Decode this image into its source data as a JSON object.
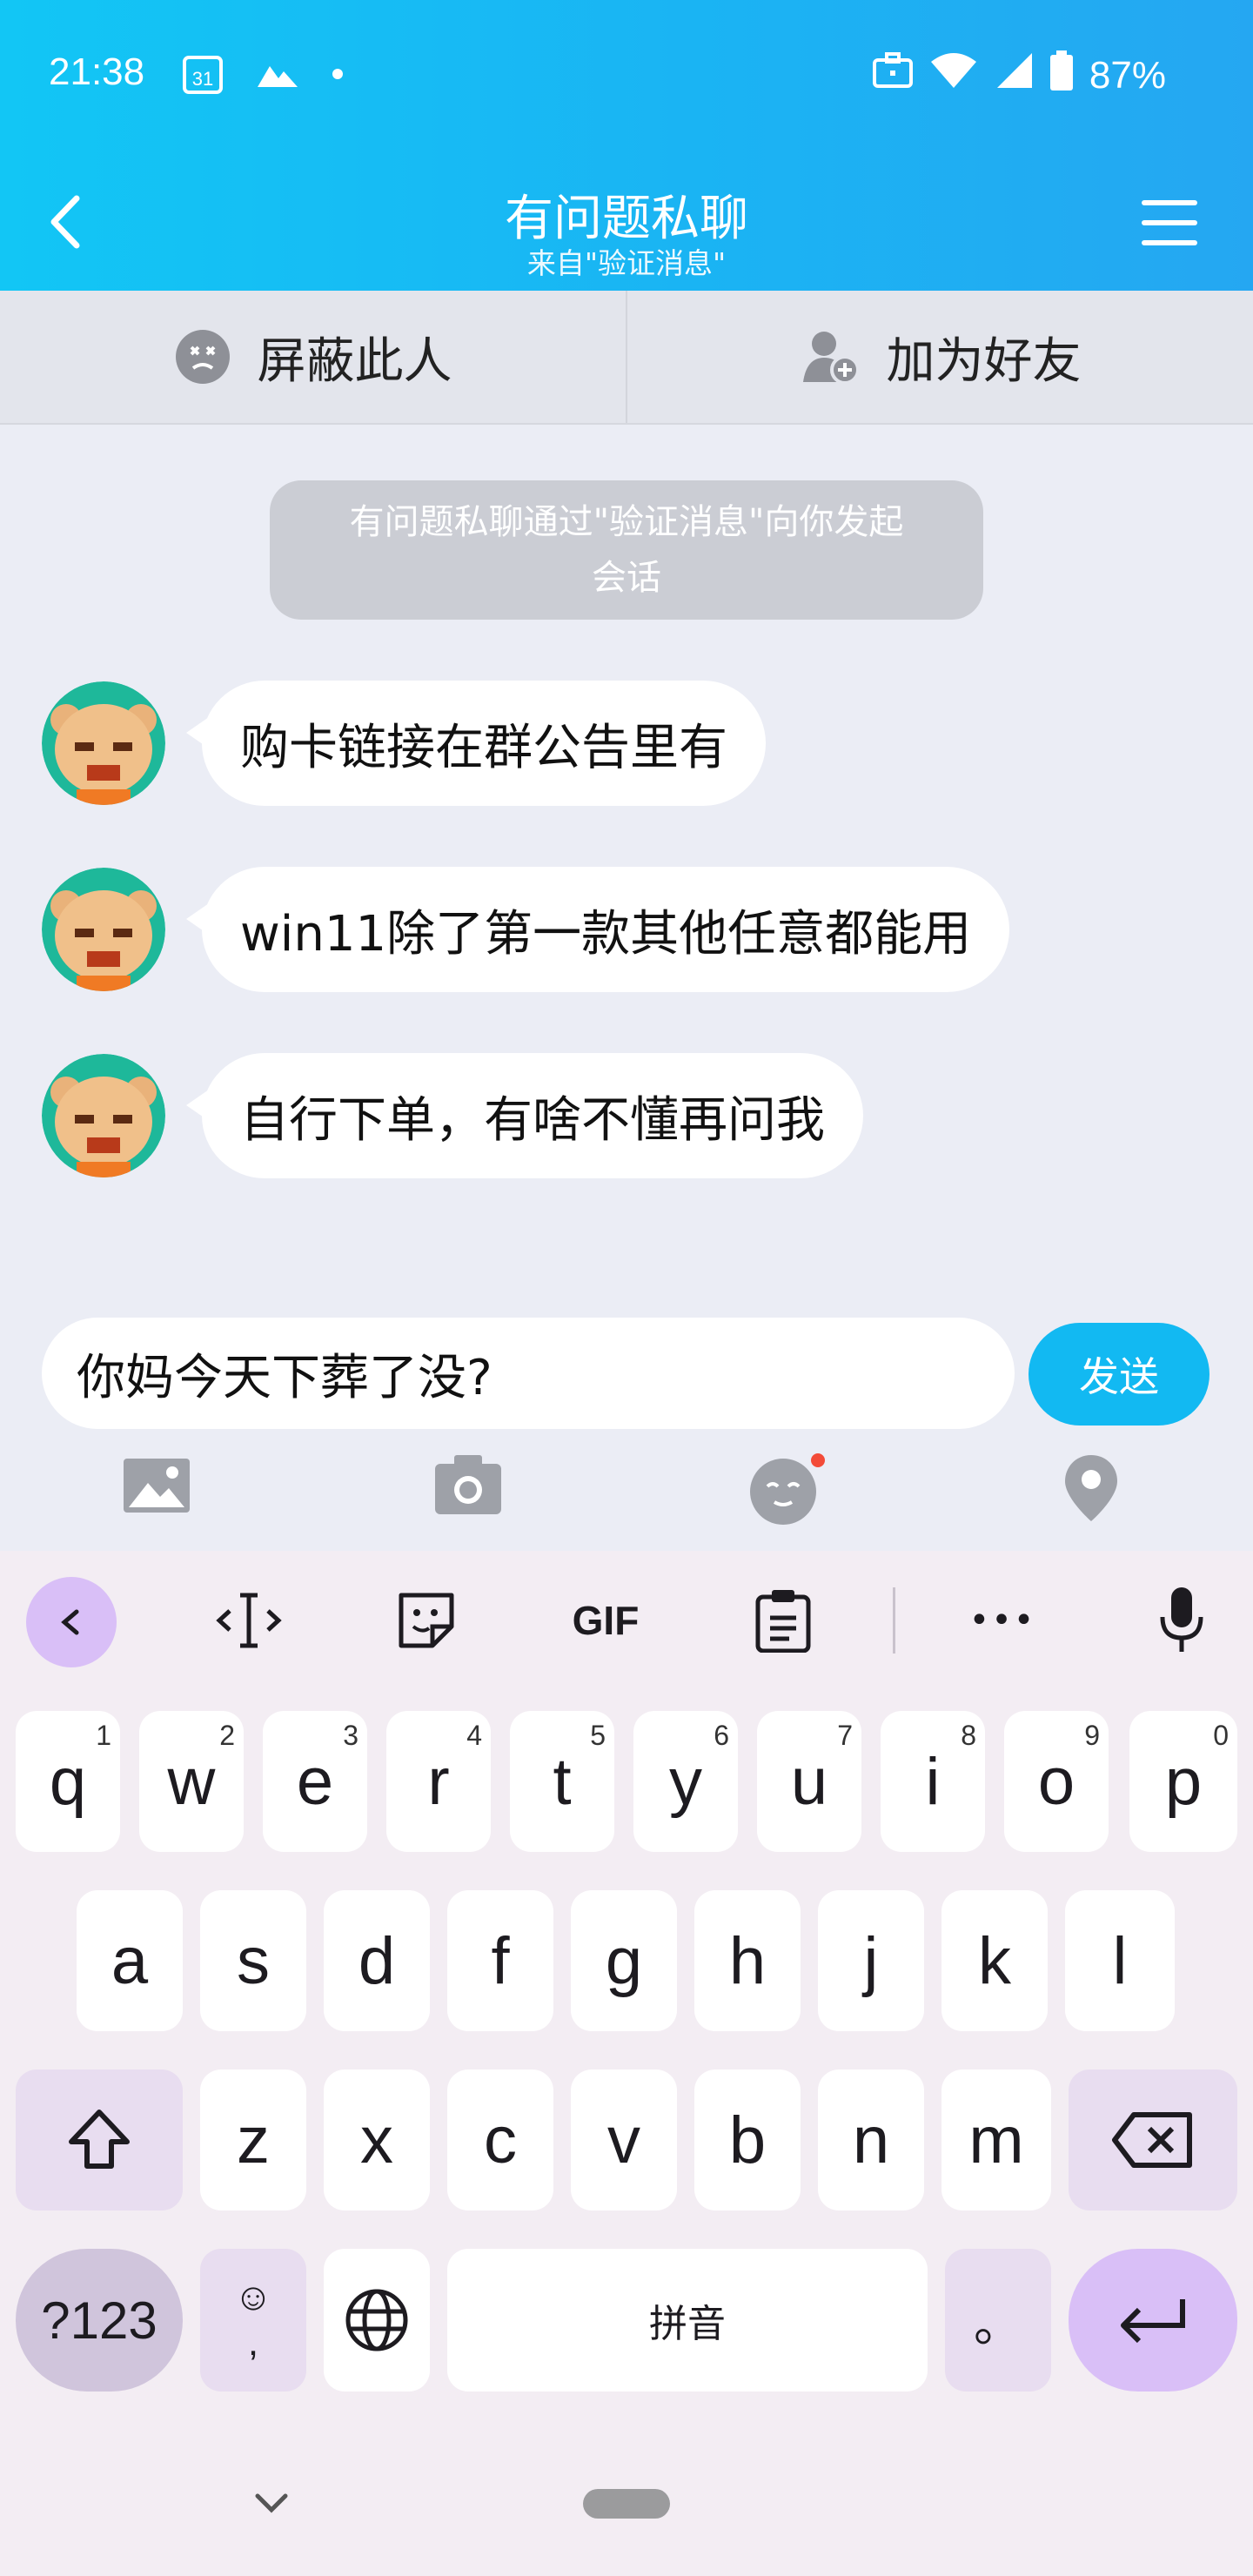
{
  "status_bar": {
    "time": "21:38",
    "calendar_day": "31",
    "battery": "87%",
    "icons": [
      "calendar-icon",
      "photos-icon",
      "dot-icon",
      "work-briefcase-icon",
      "wifi-icon",
      "signal-icon",
      "battery-icon"
    ]
  },
  "header": {
    "title": "有问题私聊",
    "subtitle": "来自\"验证消息\"",
    "icons": [
      "back-arrow-icon",
      "menu-icon"
    ]
  },
  "actions": {
    "block_label": "屏蔽此人",
    "add_friend_label": "加为好友"
  },
  "notice": {
    "line1": "有问题私聊通过\"验证消息\"向你发起",
    "line2": "会话"
  },
  "messages": [
    {
      "text": "购卡链接在群公告里有"
    },
    {
      "text": "win11除了第一款其他任意都能用"
    },
    {
      "text": "自行下单，有啥不懂再问我"
    }
  ],
  "composer": {
    "input_value": "你妈今天下葬了没?",
    "send_label": "发送",
    "tools": [
      "image-icon",
      "camera-icon",
      "emoji-icon",
      "location-icon"
    ]
  },
  "keyboard": {
    "toolbar": {
      "gif_label": "GIF",
      "more_label": "•••"
    },
    "row1": [
      {
        "key": "q",
        "hint": "1"
      },
      {
        "key": "w",
        "hint": "2"
      },
      {
        "key": "e",
        "hint": "3"
      },
      {
        "key": "r",
        "hint": "4"
      },
      {
        "key": "t",
        "hint": "5"
      },
      {
        "key": "y",
        "hint": "6"
      },
      {
        "key": "u",
        "hint": "7"
      },
      {
        "key": "i",
        "hint": "8"
      },
      {
        "key": "o",
        "hint": "9"
      },
      {
        "key": "p",
        "hint": "0"
      }
    ],
    "row2": [
      "a",
      "s",
      "d",
      "f",
      "g",
      "h",
      "j",
      "k",
      "l"
    ],
    "row3": [
      "z",
      "x",
      "c",
      "v",
      "b",
      "n",
      "m"
    ],
    "symbols_label": "?123",
    "emoji_comma_label": "☺\n,",
    "space_label": "拼音",
    "period_label": "。"
  },
  "colors": {
    "header_gradient_start": "#12c6f5",
    "header_gradient_end": "#25a7f2",
    "send_button": "#12b9f2",
    "chat_background": "#ebedf5",
    "keyboard_background": "#f3edf3",
    "enter_key": "#d9bff7"
  }
}
